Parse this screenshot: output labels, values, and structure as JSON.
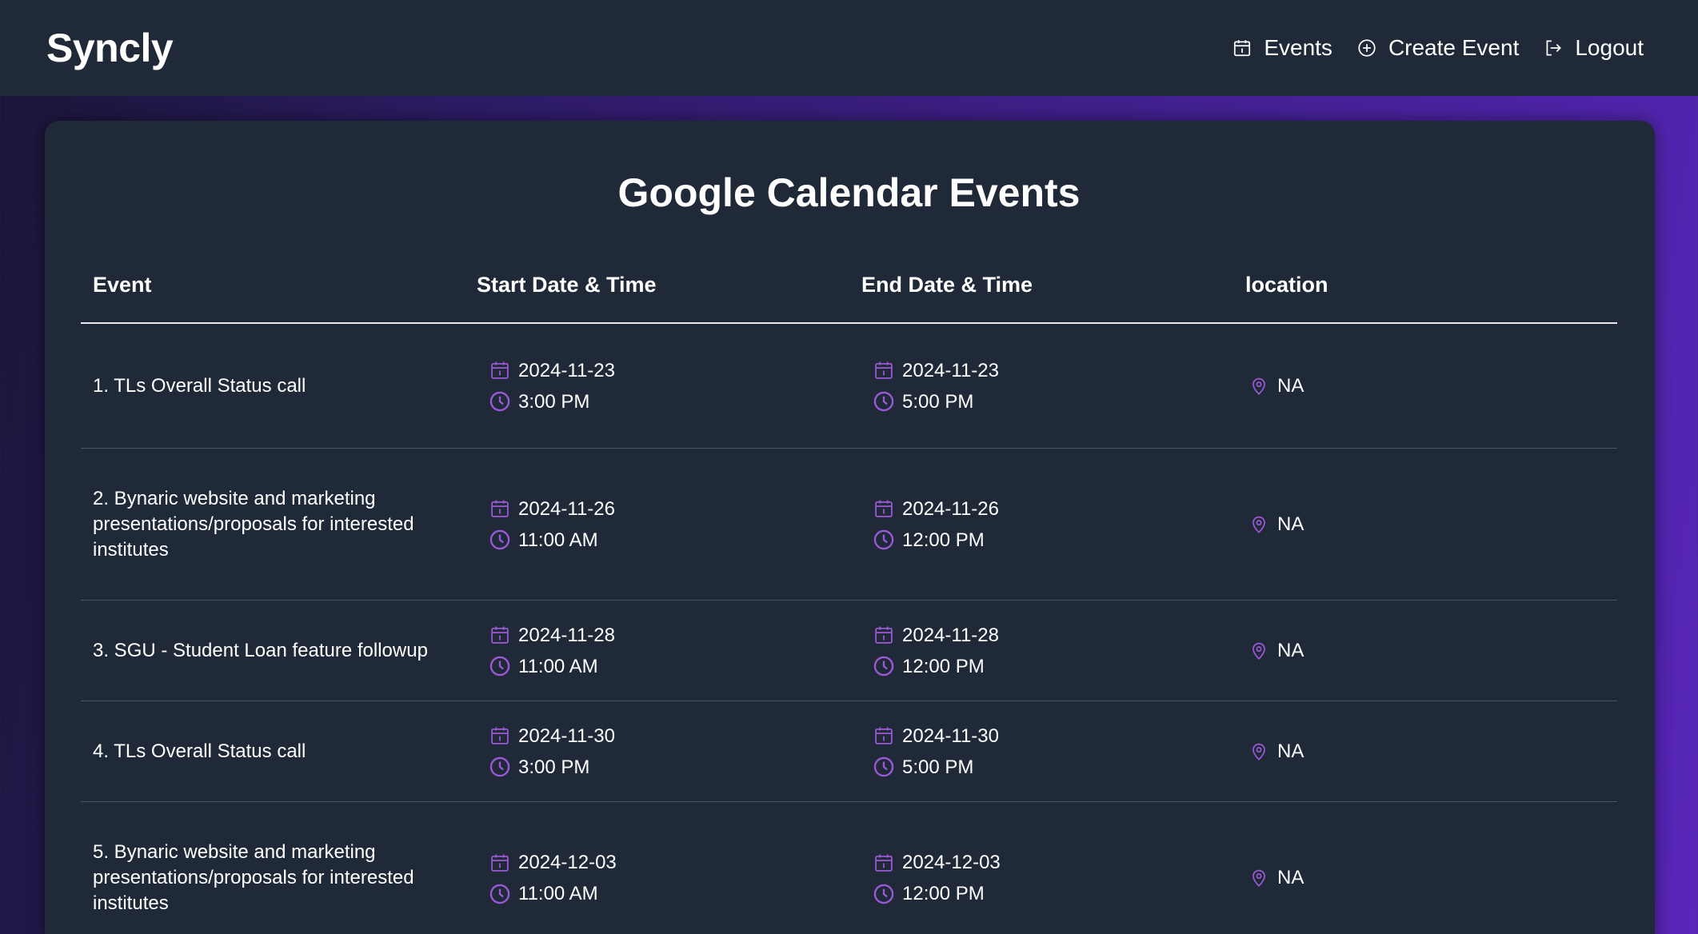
{
  "app": {
    "name": "Syncly"
  },
  "nav": [
    {
      "label": "Events",
      "icon": "calendar-icon"
    },
    {
      "label": "Create Event",
      "icon": "plus-circle-icon"
    },
    {
      "label": "Logout",
      "icon": "logout-icon"
    }
  ],
  "page": {
    "title": "Google Calendar Events"
  },
  "table": {
    "headers": [
      "Event",
      "Start Date & Time",
      "End Date & Time",
      "location"
    ],
    "rows": [
      {
        "event": "1. TLs Overall Status call",
        "start_date": "2024-11-23",
        "start_time": "3:00 PM",
        "end_date": "2024-11-23",
        "end_time": "5:00 PM",
        "location": "NA"
      },
      {
        "event": "2. Bynaric website and marketing presentations/proposals for interested institutes",
        "start_date": "2024-11-26",
        "start_time": "11:00 AM",
        "end_date": "2024-11-26",
        "end_time": "12:00 PM",
        "location": "NA"
      },
      {
        "event": "3. SGU - Student Loan feature followup",
        "start_date": "2024-11-28",
        "start_time": "11:00 AM",
        "end_date": "2024-11-28",
        "end_time": "12:00 PM",
        "location": "NA"
      },
      {
        "event": "4. TLs Overall Status call",
        "start_date": "2024-11-30",
        "start_time": "3:00 PM",
        "end_date": "2024-11-30",
        "end_time": "5:00 PM",
        "location": "NA"
      },
      {
        "event": "5. Bynaric website and marketing presentations/proposals for interested institutes",
        "start_date": "2024-12-03",
        "start_time": "11:00 AM",
        "end_date": "2024-12-03",
        "end_time": "12:00 PM",
        "location": "NA"
      }
    ]
  },
  "colors": {
    "accent": "#9b59d6",
    "surface": "#202938",
    "divider": "#4a5363"
  }
}
